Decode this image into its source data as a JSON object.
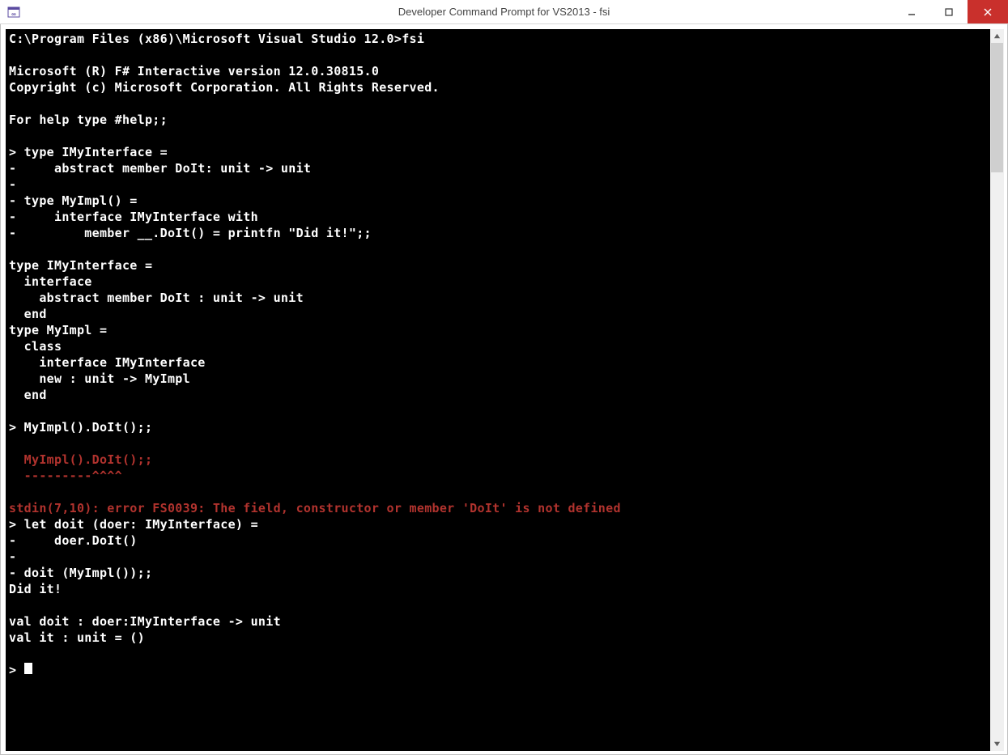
{
  "window": {
    "title": "Developer Command Prompt for VS2013 - fsi"
  },
  "colors": {
    "error": "#b1332e",
    "bg": "#000000",
    "fg": "#ffffff",
    "close": "#c9302c"
  },
  "console": {
    "lines": [
      {
        "t": "C:\\Program Files (x86)\\Microsoft Visual Studio 12.0>fsi",
        "c": "w"
      },
      {
        "t": "",
        "c": "w"
      },
      {
        "t": "Microsoft (R) F# Interactive version 12.0.30815.0",
        "c": "w"
      },
      {
        "t": "Copyright (c) Microsoft Corporation. All Rights Reserved.",
        "c": "w"
      },
      {
        "t": "",
        "c": "w"
      },
      {
        "t": "For help type #help;;",
        "c": "w"
      },
      {
        "t": "",
        "c": "w"
      },
      {
        "t": "> type IMyInterface =",
        "c": "w"
      },
      {
        "t": "-     abstract member DoIt: unit -> unit",
        "c": "w"
      },
      {
        "t": "-",
        "c": "w"
      },
      {
        "t": "- type MyImpl() =",
        "c": "w"
      },
      {
        "t": "-     interface IMyInterface with",
        "c": "w"
      },
      {
        "t": "-         member __.DoIt() = printfn \"Did it!\";;",
        "c": "w"
      },
      {
        "t": "",
        "c": "w"
      },
      {
        "t": "type IMyInterface =",
        "c": "w"
      },
      {
        "t": "  interface",
        "c": "w"
      },
      {
        "t": "    abstract member DoIt : unit -> unit",
        "c": "w"
      },
      {
        "t": "  end",
        "c": "w"
      },
      {
        "t": "type MyImpl =",
        "c": "w"
      },
      {
        "t": "  class",
        "c": "w"
      },
      {
        "t": "    interface IMyInterface",
        "c": "w"
      },
      {
        "t": "    new : unit -> MyImpl",
        "c": "w"
      },
      {
        "t": "  end",
        "c": "w"
      },
      {
        "t": "",
        "c": "w"
      },
      {
        "t": "> MyImpl().DoIt();;",
        "c": "w"
      },
      {
        "t": "",
        "c": "w"
      },
      {
        "t": "  MyImpl().DoIt();;",
        "c": "r"
      },
      {
        "t": "  ---------^^^^",
        "c": "r"
      },
      {
        "t": "",
        "c": "w"
      },
      {
        "t": "stdin(7,10): error FS0039: The field, constructor or member 'DoIt' is not defined",
        "c": "r"
      },
      {
        "t": "> let doit (doer: IMyInterface) =",
        "c": "w"
      },
      {
        "t": "-     doer.DoIt()",
        "c": "w"
      },
      {
        "t": "-",
        "c": "w"
      },
      {
        "t": "- doit (MyImpl());;",
        "c": "w"
      },
      {
        "t": "Did it!",
        "c": "w"
      },
      {
        "t": "",
        "c": "w"
      },
      {
        "t": "val doit : doer:IMyInterface -> unit",
        "c": "w"
      },
      {
        "t": "val it : unit = ()",
        "c": "w"
      },
      {
        "t": "",
        "c": "w"
      },
      {
        "t": "> ",
        "c": "w",
        "cursor": true
      }
    ]
  }
}
